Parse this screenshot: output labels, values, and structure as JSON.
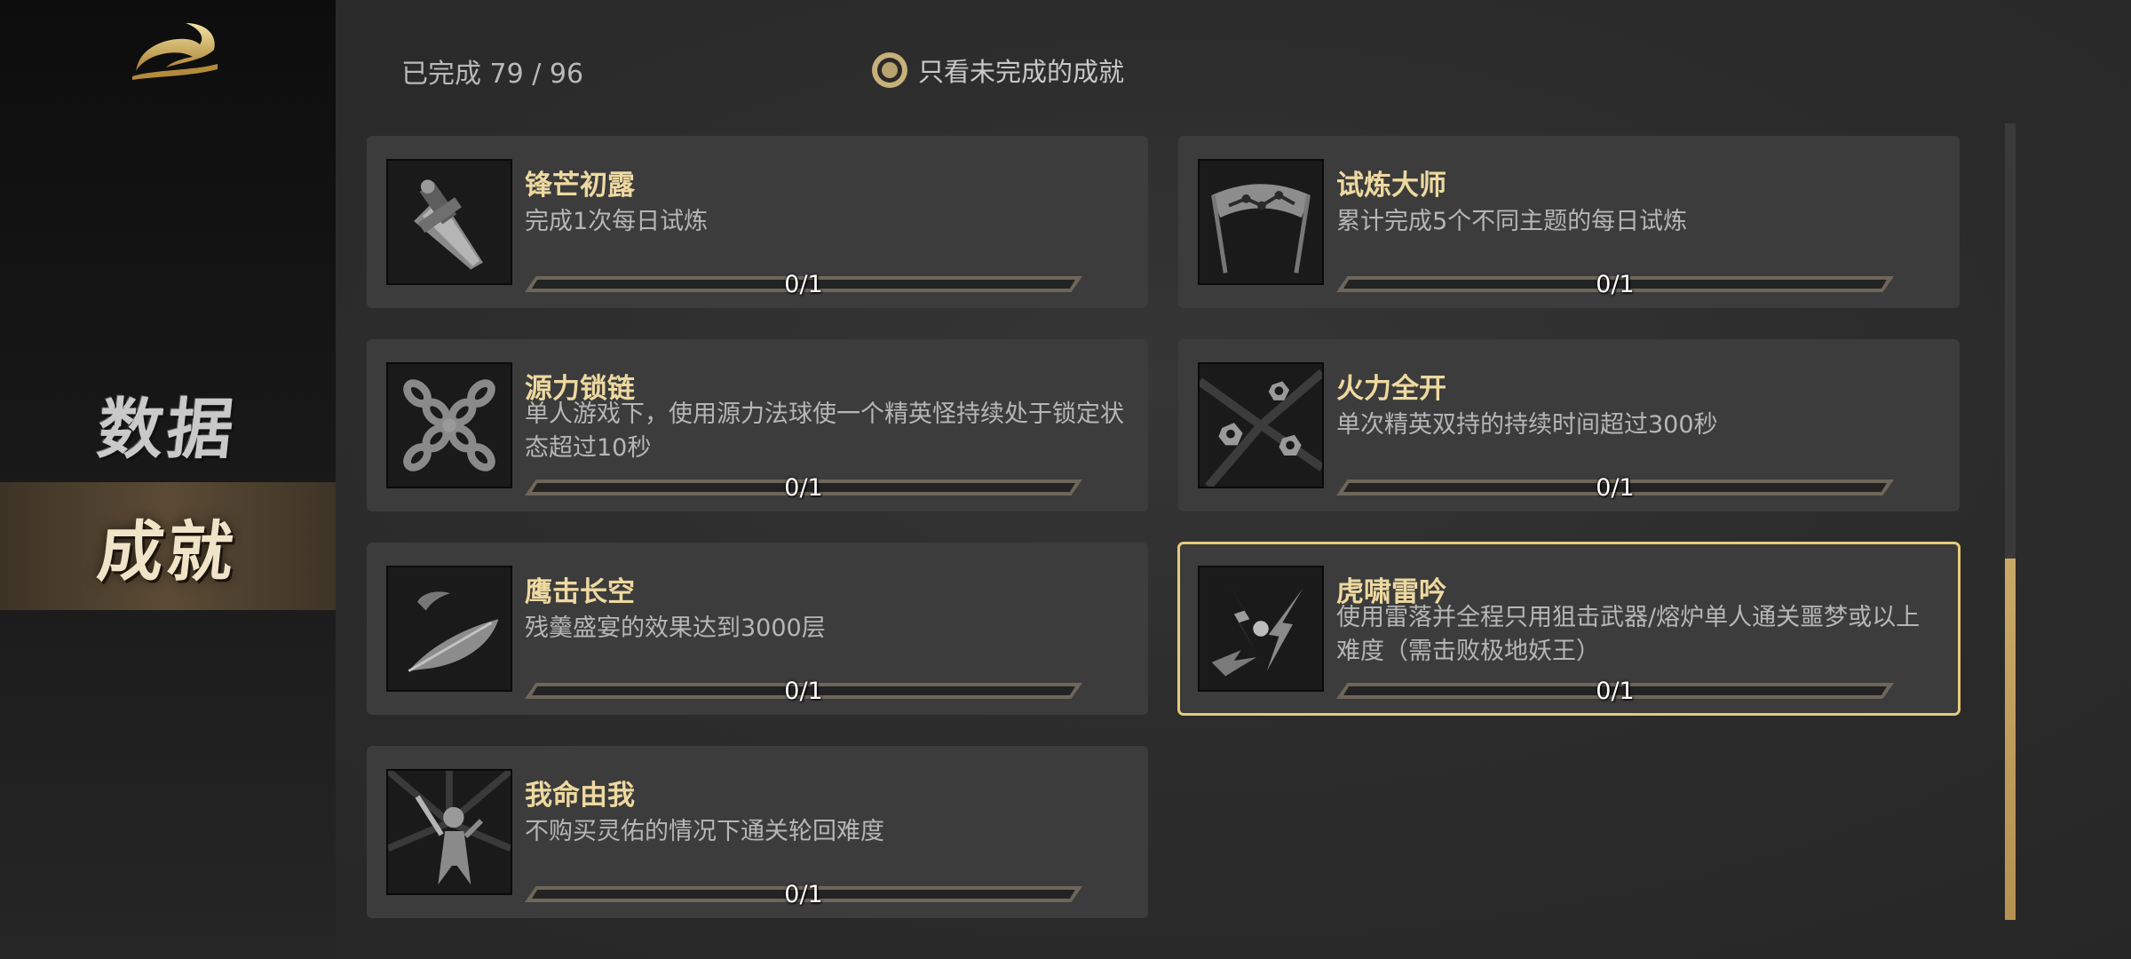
{
  "sidebar": {
    "logo": "logo-emblem",
    "items": [
      {
        "label": "数据",
        "active": false
      },
      {
        "label": "成就",
        "active": true
      }
    ]
  },
  "header": {
    "completed_label": "已完成 79 / 96",
    "filter_label": "只看未完成的成就",
    "filter_checked": true
  },
  "achievements": [
    {
      "title": "锋芒初露",
      "desc": "完成1次每日试炼",
      "progress": "0/1",
      "fraction": 0,
      "icon": "sword-icon"
    },
    {
      "title": "试炼大师",
      "desc": "累计完成5个不同主题的每日试炼",
      "progress": "0/1",
      "fraction": 0,
      "icon": "banner-icon"
    },
    {
      "title": "源力锁链",
      "desc": "单人游戏下，使用源力法球使一个精英怪持续处于锁定状态超过10秒",
      "progress": "0/1",
      "fraction": 0,
      "icon": "chain-icon"
    },
    {
      "title": "火力全开",
      "desc": "单次精英双持的持续时间超过300秒",
      "progress": "0/1",
      "fraction": 0,
      "icon": "gear-burst-icon"
    },
    {
      "title": "鹰击长空",
      "desc": "残羹盛宴的效果达到3000层",
      "progress": "0/1",
      "fraction": 0,
      "icon": "feather-icon"
    },
    {
      "title": "虎啸雷吟",
      "desc": "使用雷落并全程只用狙击武器/熔炉单人通关噩梦或以上难度（需击败极地妖王）",
      "progress": "0/1",
      "fraction": 0,
      "icon": "lightning-icon",
      "selected": true
    },
    {
      "title": "我命由我",
      "desc": "不购买灵佑的情况下通关轮回难度",
      "progress": "0/1",
      "fraction": 0,
      "icon": "hero-icon"
    }
  ],
  "colors": {
    "accent": "#e6cc79",
    "title": "#eed9a0",
    "card_bg": "#3c3c3c",
    "scroll_thumb": "#c2a060"
  }
}
